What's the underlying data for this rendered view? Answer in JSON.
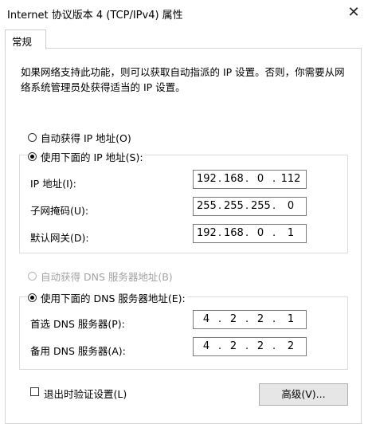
{
  "window": {
    "title": "Internet 协议版本 4 (TCP/IPv4) 属性",
    "close_symbol": "✕"
  },
  "tabs": [
    {
      "label": "常规",
      "active": true
    }
  ],
  "description_lines": [
    "如果网络支持此功能，则可以获取自动指派的 IP 设置。否则，你需要从网",
    "络系统管理员处获得适当的 IP 设置。"
  ],
  "ip_mode": {
    "auto_label": "自动获得 IP 地址(O)",
    "auto_selected": false,
    "manual_label": "使用下面的 IP 地址(S):",
    "manual_selected": true
  },
  "ip_fields": [
    {
      "label": "IP 地址(I):",
      "octets": [
        "192",
        "168",
        "0",
        "112"
      ]
    },
    {
      "label": "子网掩码(U):",
      "octets": [
        "255",
        "255",
        "255",
        "0"
      ]
    },
    {
      "label": "默认网关(D):",
      "octets": [
        "192",
        "168",
        "0",
        "1"
      ]
    }
  ],
  "dns_mode": {
    "auto_label": "自动获得 DNS 服务器地址(B)",
    "auto_selected": false,
    "auto_disabled": true,
    "manual_label": "使用下面的 DNS 服务器地址(E):",
    "manual_selected": true
  },
  "dns_fields": [
    {
      "label": "首选 DNS 服务器(P):",
      "octets": [
        "4",
        "2",
        "2",
        "1"
      ]
    },
    {
      "label": "备用 DNS 服务器(A):",
      "octets": [
        "4",
        "2",
        "2",
        "2"
      ]
    }
  ],
  "validate_on_exit": {
    "label": "退出时验证设置(L)",
    "checked": false
  },
  "advanced_button": {
    "label": "高级(V)..."
  }
}
